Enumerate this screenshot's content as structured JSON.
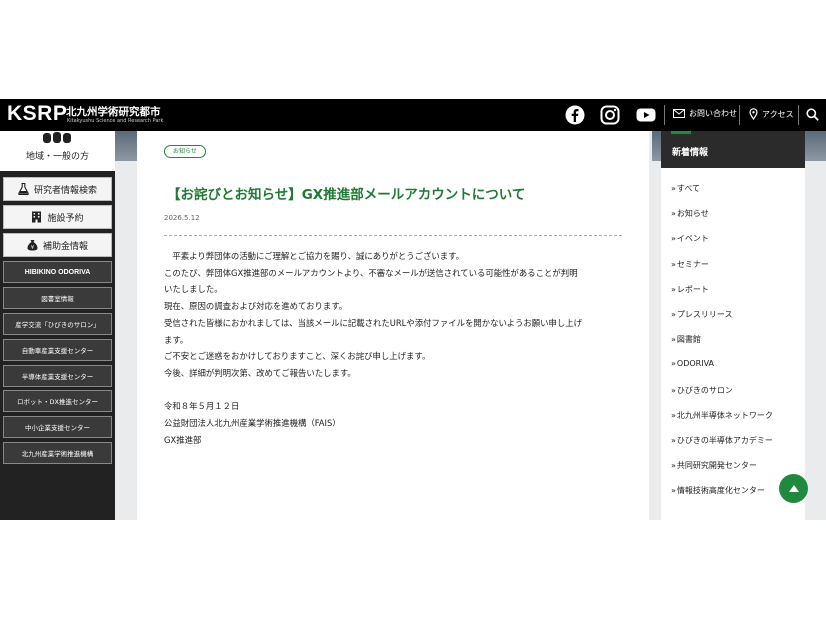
{
  "header": {
    "logo": "KSRP",
    "logo_jp": "北九州学術研究都市",
    "logo_en": "Kitakyushu Science and Research Park",
    "contact_label": "お問い合わせ",
    "access_label": "アクセス"
  },
  "sidebar": {
    "top_label": "地域・一般の方",
    "big_items": [
      {
        "label": "研究者情報検索",
        "icon": "flask-icon"
      },
      {
        "label": "施設予約",
        "icon": "building-icon"
      },
      {
        "label": "補助金情報",
        "icon": "money-bag-icon"
      }
    ],
    "small_items": [
      "HIBIKINO ODORIVA",
      "図書室情報",
      "産学交流「ひびきのサロン」",
      "自動車産業支援センター",
      "半導体産業支援センター",
      "ロボット・DX推進センター",
      "中小企業支援センター",
      "北九州産業学術推進機構"
    ]
  },
  "article": {
    "tag": "お知らせ",
    "title": "【お詫びとお知らせ】GX推進部メールアカウントについて",
    "date": "2026.5.12",
    "body": [
      "　平素より弊団体の活動にご理解とご協力を賜り、誠にありがとうございます。",
      "このたび、弊団体GX推進部のメールアカウントより、不審なメールが送信されている可能性があることが判明",
      "いたしました。",
      "現在、原因の調査および対応を進めております。",
      "受信された皆様におかれましては、当該メールに記載されたURLや添付ファイルを開かないようお願い申し上げ",
      "ます。",
      "ご不安とご迷惑をおかけしておりますこと、深くお詫び申し上げます。",
      "今後、詳細が判明次第、改めてご報告いたします。",
      "",
      "令和８年５月１２日",
      "公益財団法人北九州産業学術推進機構（FAIS）",
      "GX推進部"
    ]
  },
  "right_sidebar": {
    "title": "新着情報",
    "items": [
      "すべて",
      "お知らせ",
      "イベント",
      "セミナー",
      "レポート",
      "プレスリリース",
      "図書館",
      "ODORIVA",
      "ひびきのサロン",
      "北九州半導体ネットワーク",
      "ひびきの半導体アカデミー",
      "共同研究開発センター",
      "情報技術高度化センター"
    ]
  },
  "colors": {
    "accent": "#1f8a3e",
    "header_bg": "#000000",
    "sidebar_bg": "#222222"
  }
}
